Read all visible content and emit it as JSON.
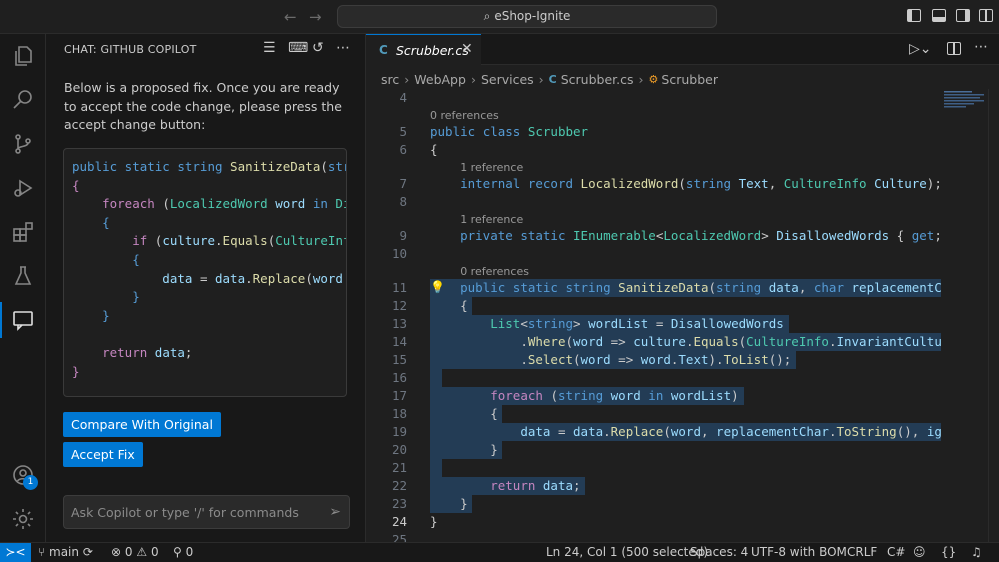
{
  "titlebar": {
    "command_center": "eShop-Ignite"
  },
  "chat": {
    "title": "CHAT: GITHUB COPILOT",
    "description": "Below is a proposed fix. Once you are ready to accept the code change, please press the accept change button:",
    "code_lines": [
      "public static string SanitizeData(stri",
      "{",
      "    foreach (LocalizedWord word in Dis",
      "    {",
      "        if (culture.Equals(CultureInfo",
      "        {",
      "            data = data.Replace(word.T",
      "        }",
      "    }",
      "",
      "    return data;",
      "}"
    ],
    "compare_button": "Compare With Original",
    "accept_button": "Accept Fix",
    "input_placeholder": "Ask Copilot or type '/' for commands",
    "account_badge": "1"
  },
  "editor": {
    "tab": {
      "label": "Scrubber.cs",
      "close": "✕"
    },
    "breadcrumb": [
      "src",
      "WebApp",
      "Services",
      "Scrubber.cs",
      "Scrubber"
    ],
    "lines": [
      {
        "n": "4",
        "text": ""
      },
      {
        "n": "5",
        "text": "public class Scrubber",
        "lens": "0 references"
      },
      {
        "n": "6",
        "text": "{"
      },
      {
        "n": "7",
        "text": "    internal record LocalizedWord(string Text, CultureInfo Culture);",
        "lens": "1 reference"
      },
      {
        "n": "8",
        "text": ""
      },
      {
        "n": "9",
        "text": "    private static IEnumerable<LocalizedWord> DisallowedWords { get; }",
        "lens": "1 reference"
      },
      {
        "n": "10",
        "text": ""
      },
      {
        "n": "11",
        "text": "    public static string SanitizeData(string data, char replacementChar",
        "lens": "0 references"
      },
      {
        "n": "12",
        "text": "    {"
      },
      {
        "n": "13",
        "text": "        List<string> wordList = DisallowedWords"
      },
      {
        "n": "14",
        "text": "            .Where(word => culture.Equals(CultureInfo.InvariantCulture)"
      },
      {
        "n": "15",
        "text": "            .Select(word => word.Text).ToList();"
      },
      {
        "n": "16",
        "text": ""
      },
      {
        "n": "17",
        "text": "        foreach (string word in wordList)"
      },
      {
        "n": "18",
        "text": "        {"
      },
      {
        "n": "19",
        "text": "            data = data.Replace(word, replacementChar.ToString(), ignor"
      },
      {
        "n": "20",
        "text": "        }"
      },
      {
        "n": "21",
        "text": ""
      },
      {
        "n": "22",
        "text": "        return data;"
      },
      {
        "n": "23",
        "text": "    }"
      },
      {
        "n": "24",
        "text": "}"
      },
      {
        "n": "25",
        "text": ""
      }
    ],
    "current_line": "24"
  },
  "statusbar": {
    "branch": "main",
    "errors": "0",
    "warnings": "0",
    "ports": "0",
    "position": "Ln 24, Col 1 (500 selected)",
    "spaces": "Spaces: 4",
    "encoding": "UTF-8 with BOM",
    "eol": "CRLF",
    "language": "C#"
  },
  "colors": {
    "accent": "#0078d4",
    "keyword": "#569cd6",
    "type": "#4ec9b0",
    "function": "#dcdcaa",
    "variable": "#9cdcfe",
    "control": "#c586c0"
  }
}
